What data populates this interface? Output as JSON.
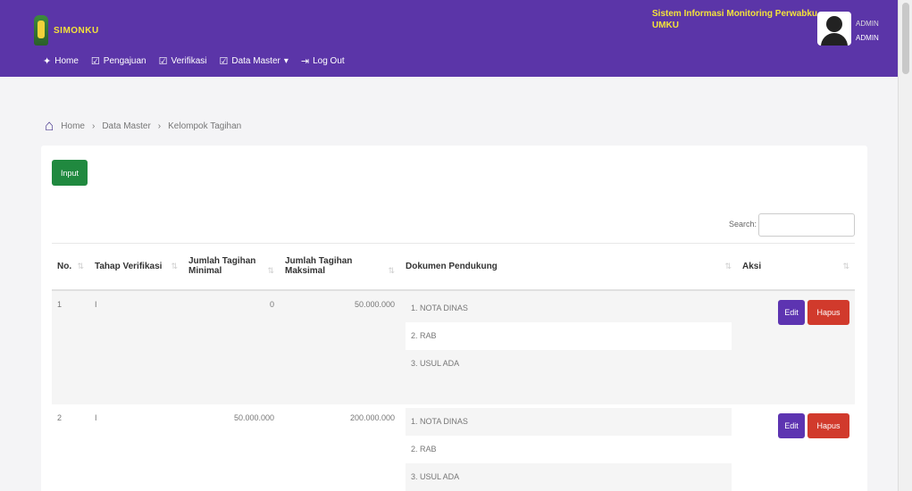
{
  "header": {
    "brand": "SIMONKU",
    "system_title": "Sistem Informasi Monitoring Perwabku UMKU",
    "user_name": "ADMIN",
    "user_role": "ADMIN"
  },
  "nav": [
    {
      "label": "Home",
      "icon": "home-icon"
    },
    {
      "label": "Pengajuan",
      "icon": "checklist-icon"
    },
    {
      "label": "Verifikasi",
      "icon": "checklist-icon"
    },
    {
      "label": "Data Master",
      "icon": "checklist-icon"
    },
    {
      "label": "Log Out",
      "icon": "logout-icon"
    }
  ],
  "breadcrumb": [
    "Home",
    "Data Master",
    "Kelompok Tagihan"
  ],
  "toolbar": {
    "input_label": "Input"
  },
  "search": {
    "label": "Search:",
    "value": ""
  },
  "table": {
    "headers": [
      "No.",
      "Tahap Verifikasi",
      "Jumlah Tagihan Minimal",
      "Jumlah Tagihan Maksimal",
      "Dokumen Pendukung",
      "Aksi"
    ],
    "rows": [
      {
        "no": "1",
        "tahap": "I",
        "min": "0",
        "max": "50.000.000",
        "docs": [
          "1. NOTA DINAS",
          "2. RAB",
          "3. USUL ADA"
        ]
      },
      {
        "no": "2",
        "tahap": "I",
        "min": "50.000.000",
        "max": "200.000.000",
        "docs": [
          "1. NOTA DINAS",
          "2. RAB",
          "3. USUL ADA"
        ]
      }
    ],
    "edit_label": "Edit",
    "delete_label": "Hapus"
  },
  "colors": {
    "header_bg": "#5b35a8",
    "brand_text": "#f3e23a",
    "input_button": "#20893f",
    "edit_button": "#5d34b1",
    "delete_button": "#d13a2c"
  }
}
